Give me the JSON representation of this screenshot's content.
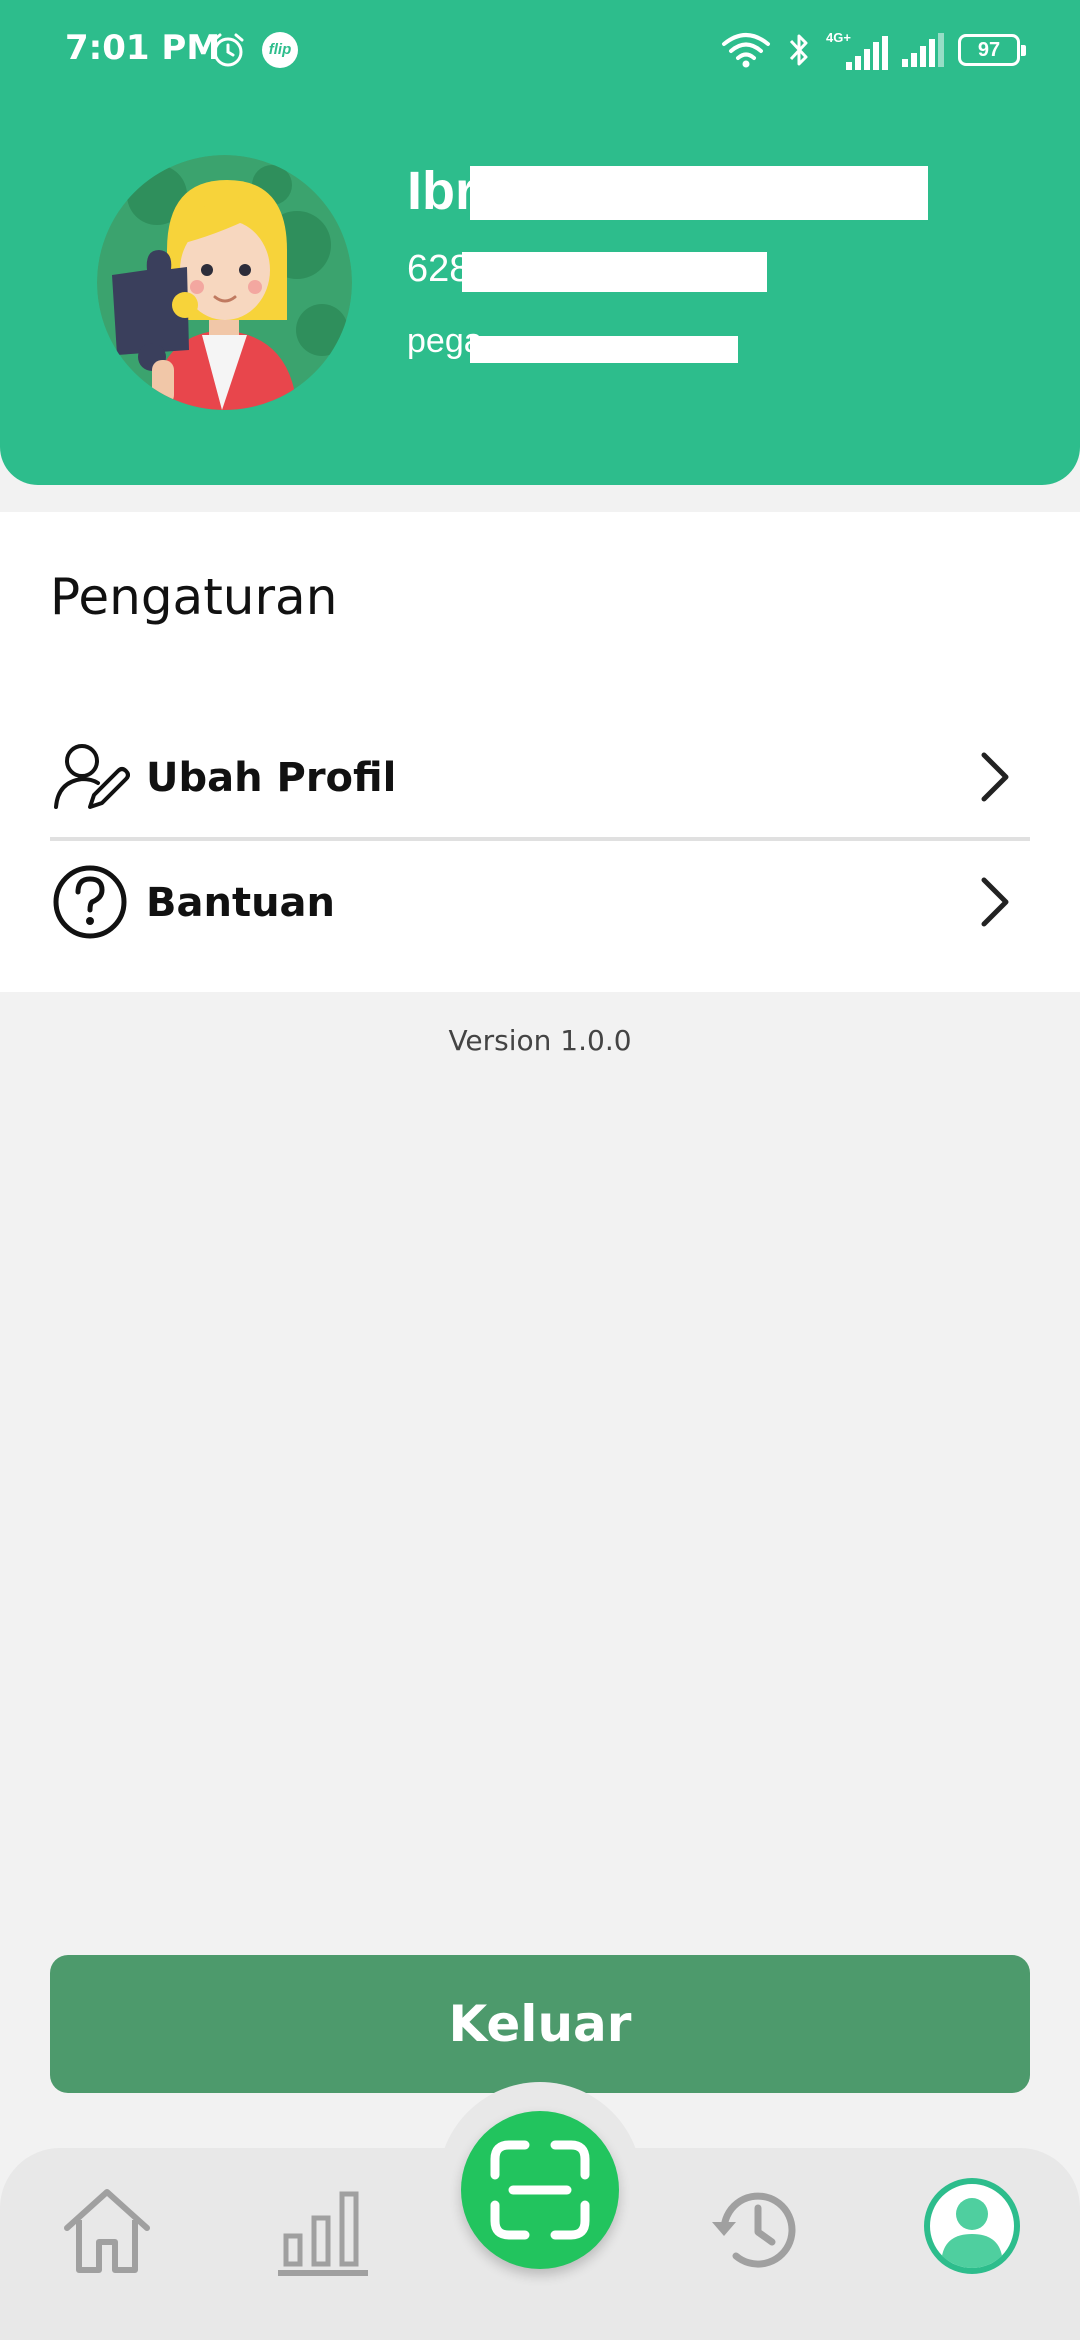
{
  "status_bar": {
    "time": "7:01 PM",
    "flip_badge": "flip",
    "network_type": "4G+",
    "battery": "97"
  },
  "profile": {
    "name": "Ibr",
    "phone": "628",
    "email": "pega"
  },
  "settings": {
    "title": "Pengaturan",
    "items": [
      {
        "label": "Ubah Profil",
        "icon": "edit-profile-icon"
      },
      {
        "label": "Bantuan",
        "icon": "help-icon"
      }
    ]
  },
  "version": "Version 1.0.0",
  "logout_label": "Keluar",
  "bottom_nav": [
    {
      "icon": "home-icon",
      "active": false
    },
    {
      "icon": "stats-icon",
      "active": false
    },
    {
      "icon": "scan-icon",
      "active": false
    },
    {
      "icon": "history-icon",
      "active": false
    },
    {
      "icon": "profile-icon",
      "active": true
    }
  ],
  "colors": {
    "header": "#2dbd8c",
    "logout_button": "#4d9a6c",
    "scan_button": "#22c45e",
    "active_nav": "#2dbd8c",
    "inactive_nav": "#a0a0a0"
  }
}
